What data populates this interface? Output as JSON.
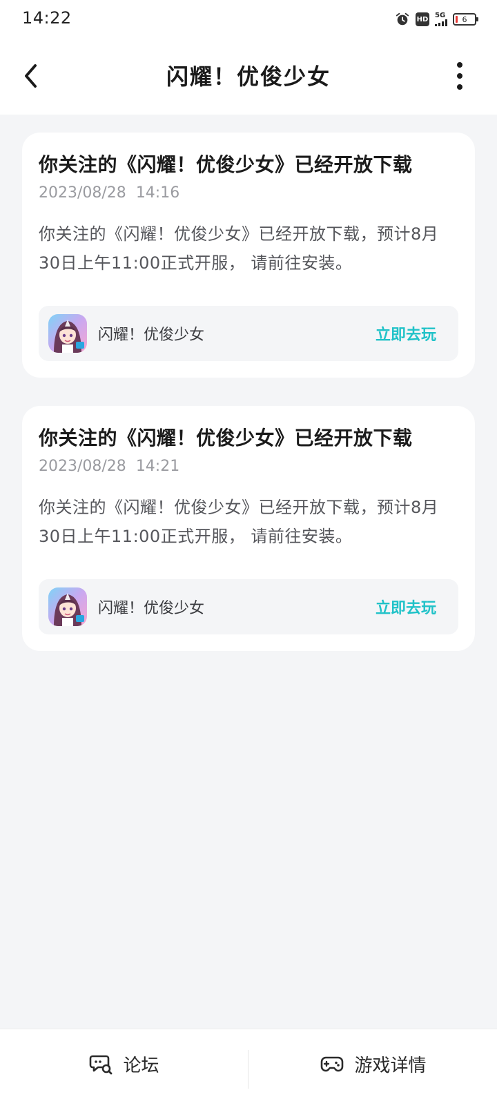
{
  "status_bar": {
    "time": "14:22",
    "hd": "HD",
    "network": "5G",
    "battery": "6"
  },
  "header": {
    "title": "闪耀！优俊少女",
    "back_icon": "chevron-left-icon",
    "more_icon": "more-vertical-icon"
  },
  "notifications": [
    {
      "title": "你关注的《闪耀！优俊少女》已经开放下载",
      "date": "2023/08/28",
      "time": "14:16",
      "body": "你关注的《闪耀！优俊少女》已经开放下载，预计8月30日上午11:00正式开服， 请前往安装。",
      "game_name": "闪耀！优俊少女",
      "play_label": "立即去玩"
    },
    {
      "title": "你关注的《闪耀！优俊少女》已经开放下载",
      "date": "2023/08/28",
      "time": "14:21",
      "body": "你关注的《闪耀！优俊少女》已经开放下载，预计8月30日上午11:00正式开服， 请前往安装。",
      "game_name": "闪耀！优俊少女",
      "play_label": "立即去玩"
    }
  ],
  "bottom_bar": {
    "forum_label": "论坛",
    "forum_icon": "chat-search-icon",
    "details_label": "游戏详情",
    "details_icon": "gamepad-icon"
  },
  "colors": {
    "accent": "#20c2c8",
    "background": "#f4f5f7",
    "card": "#ffffff"
  }
}
